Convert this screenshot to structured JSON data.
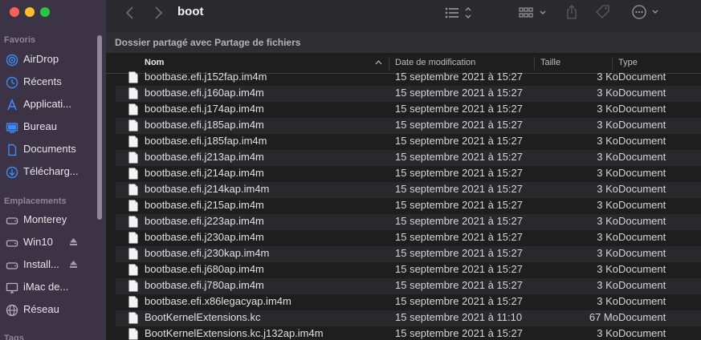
{
  "window": {
    "title": "boot",
    "path_info": "Dossier partagé avec Partage de fichiers"
  },
  "sidebar": {
    "favorites_title": "Favoris",
    "favorites": [
      {
        "label": "AirDrop",
        "icon": "airdrop-icon"
      },
      {
        "label": "Récents",
        "icon": "clock-icon"
      },
      {
        "label": "Applicati...",
        "icon": "applications-icon"
      },
      {
        "label": "Bureau",
        "icon": "desktop-icon"
      },
      {
        "label": "Documents",
        "icon": "document-icon"
      },
      {
        "label": "Télécharg...",
        "icon": "download-icon"
      }
    ],
    "locations_title": "Emplacements",
    "locations": [
      {
        "label": "Monterey",
        "icon": "drive-icon"
      },
      {
        "label": "Win10",
        "icon": "drive-icon"
      },
      {
        "label": "Install...",
        "icon": "drive-icon"
      },
      {
        "label": "iMac de...",
        "icon": "computer-icon"
      },
      {
        "label": "Réseau",
        "icon": "network-icon"
      }
    ],
    "tags_title": "Tags"
  },
  "columns": {
    "name": "Nom",
    "date": "Date de modification",
    "size": "Taille",
    "kind": "Type"
  },
  "files": [
    {
      "name": "bootbase.efi.j152fap.im4m",
      "date": "15 septembre 2021 à 15:27",
      "size": "3 Ko",
      "kind": "Document"
    },
    {
      "name": "bootbase.efi.j160ap.im4m",
      "date": "15 septembre 2021 à 15:27",
      "size": "3 Ko",
      "kind": "Document"
    },
    {
      "name": "bootbase.efi.j174ap.im4m",
      "date": "15 septembre 2021 à 15:27",
      "size": "3 Ko",
      "kind": "Document"
    },
    {
      "name": "bootbase.efi.j185ap.im4m",
      "date": "15 septembre 2021 à 15:27",
      "size": "3 Ko",
      "kind": "Document"
    },
    {
      "name": "bootbase.efi.j185fap.im4m",
      "date": "15 septembre 2021 à 15:27",
      "size": "3 Ko",
      "kind": "Document"
    },
    {
      "name": "bootbase.efi.j213ap.im4m",
      "date": "15 septembre 2021 à 15:27",
      "size": "3 Ko",
      "kind": "Document"
    },
    {
      "name": "bootbase.efi.j214ap.im4m",
      "date": "15 septembre 2021 à 15:27",
      "size": "3 Ko",
      "kind": "Document"
    },
    {
      "name": "bootbase.efi.j214kap.im4m",
      "date": "15 septembre 2021 à 15:27",
      "size": "3 Ko",
      "kind": "Document"
    },
    {
      "name": "bootbase.efi.j215ap.im4m",
      "date": "15 septembre 2021 à 15:27",
      "size": "3 Ko",
      "kind": "Document"
    },
    {
      "name": "bootbase.efi.j223ap.im4m",
      "date": "15 septembre 2021 à 15:27",
      "size": "3 Ko",
      "kind": "Document"
    },
    {
      "name": "bootbase.efi.j230ap.im4m",
      "date": "15 septembre 2021 à 15:27",
      "size": "3 Ko",
      "kind": "Document"
    },
    {
      "name": "bootbase.efi.j230kap.im4m",
      "date": "15 septembre 2021 à 15:27",
      "size": "3 Ko",
      "kind": "Document"
    },
    {
      "name": "bootbase.efi.j680ap.im4m",
      "date": "15 septembre 2021 à 15:27",
      "size": "3 Ko",
      "kind": "Document"
    },
    {
      "name": "bootbase.efi.j780ap.im4m",
      "date": "15 septembre 2021 à 15:27",
      "size": "3 Ko",
      "kind": "Document"
    },
    {
      "name": "bootbase.efi.x86legacyap.im4m",
      "date": "15 septembre 2021 à 15:27",
      "size": "3 Ko",
      "kind": "Document"
    },
    {
      "name": "BootKernelExtensions.kc",
      "date": "15 septembre 2021 à 11:10",
      "size": "67 Mo",
      "kind": "Document"
    },
    {
      "name": "BootKernelExtensions.kc.j132ap.im4m",
      "date": "15 septembre 2021 à 15:27",
      "size": "3 Ko",
      "kind": "Document"
    }
  ],
  "colors": {
    "sidebar_bg": "#3d3346",
    "accent": "#3d8af7",
    "window_bg": "#1e1e1f"
  }
}
